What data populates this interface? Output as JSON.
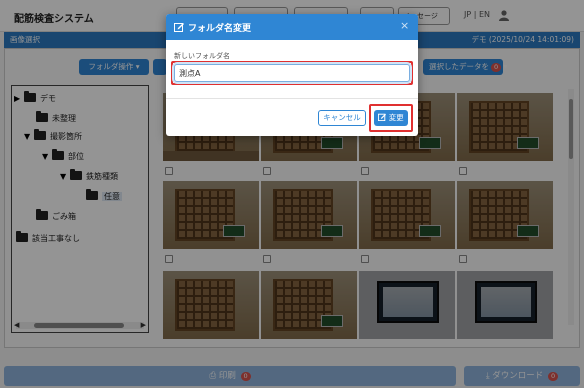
{
  "header": {
    "app_title": "配筋検査システム",
    "buttons": [
      "",
      "",
      "",
      "",
      "",
      "メッセージ"
    ],
    "lang": "JP | EN"
  },
  "subbar": {
    "left": "画像選択",
    "right": "デモ (2025/10/24 14:01:09)"
  },
  "toolbar": {
    "folder_op": "フォルダ操作 ▾",
    "selected_data": "選択したデータを",
    "selected_count": "0"
  },
  "tree": {
    "items": [
      {
        "label": "デモ",
        "caret": "▶"
      },
      {
        "label": "未整理",
        "caret": ""
      },
      {
        "label": "撮影箇所",
        "caret": "▼"
      },
      {
        "label": "部位",
        "caret": "▼"
      },
      {
        "label": "鉄筋種類",
        "caret": "▼"
      },
      {
        "label": "任意",
        "caret": ""
      },
      {
        "label": "ごみ箱",
        "caret": ""
      },
      {
        "label": "該当工事なし",
        "caret": ""
      }
    ]
  },
  "bottom": {
    "print": "印刷",
    "print_count": "0",
    "download": "ダウンロード",
    "download_count": "0"
  },
  "modal": {
    "title": "フォルダ名変更",
    "close": "×",
    "field_label": "新しいフォルダ名",
    "input_value": "測点A",
    "cancel": "キャンセル",
    "submit": "変更"
  },
  "colors": {
    "primary": "#2f86d4",
    "highlight": "#e03030",
    "badge": "#d9534f"
  },
  "icons": {
    "title_icon": "edit-icon",
    "submit_icon": "edit-icon",
    "tree_icon": "folder-icon"
  }
}
